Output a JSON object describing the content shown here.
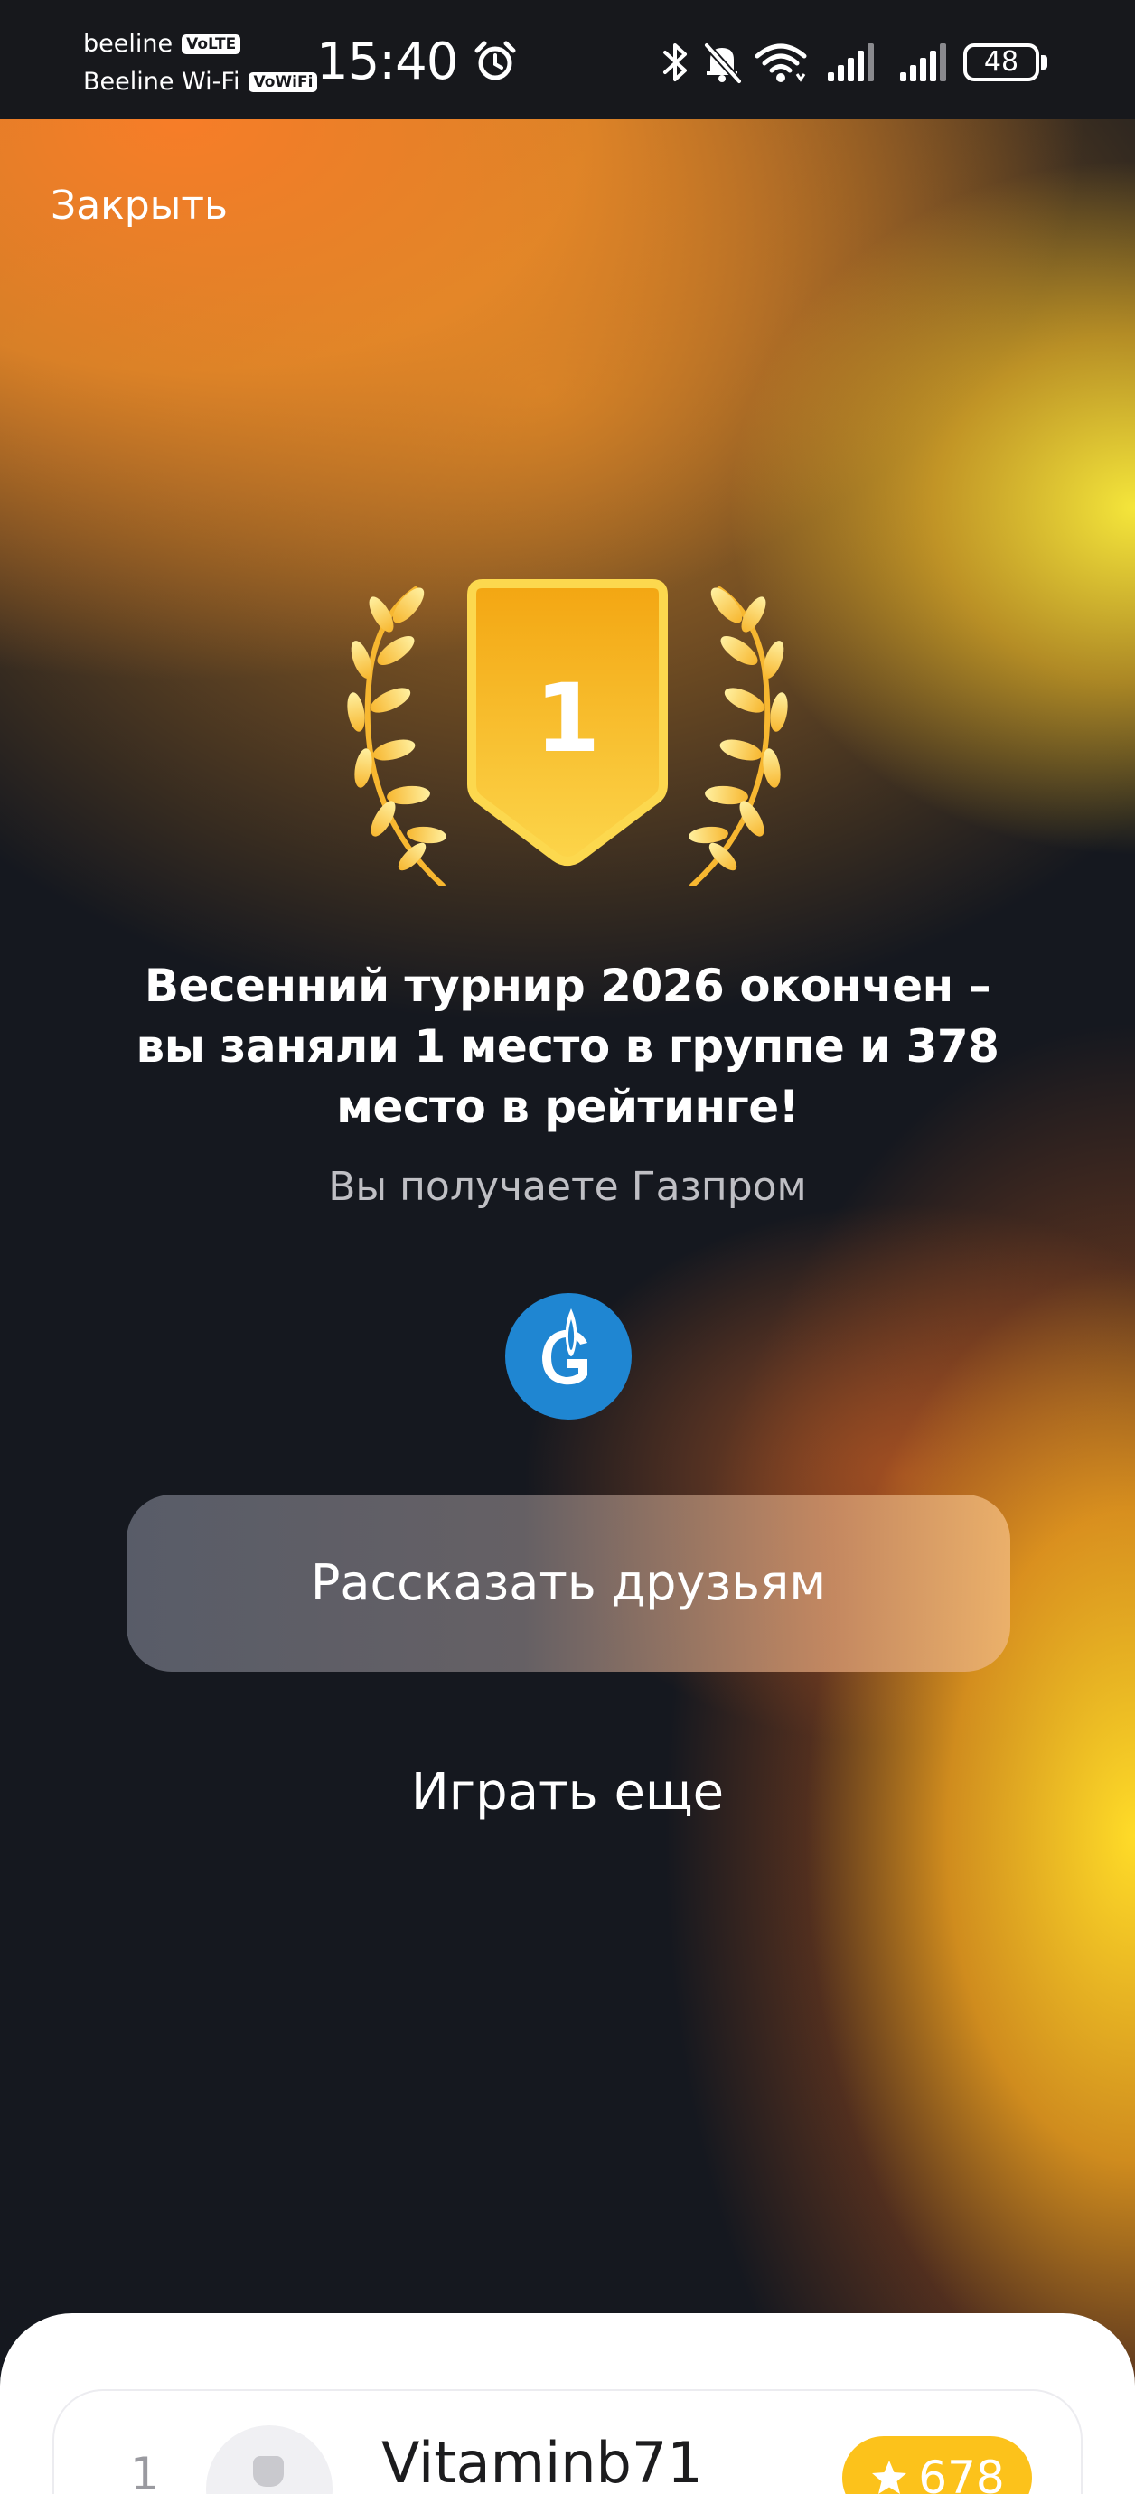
{
  "status_bar": {
    "carrier_1": "beeline",
    "carrier_1_tag": "VoLTE",
    "carrier_2": "Beeline Wi-Fi",
    "carrier_2_tag": "VoWiFi",
    "time": "15:40",
    "battery": "48",
    "icons": [
      "alarm-icon",
      "bluetooth-icon",
      "mute-icon",
      "wifi-icon",
      "signal-icon",
      "signal-icon"
    ]
  },
  "header": {
    "close_label": "Закрыть"
  },
  "result": {
    "place": "1",
    "headline": "Весенний турнир 2026 окончен – вы заняли 1 место в группе и 378 место в рейтинге!",
    "prize_text": "Вы получаете Газпром",
    "prize_icon": "gazprom-logo-icon"
  },
  "actions": {
    "share_label": "Рассказать друзьям",
    "play_again_label": "Играть еще"
  },
  "leaderboard": {
    "rows": [
      {
        "rank": "1",
        "name": "Vitaminb71",
        "score": "678"
      }
    ]
  },
  "colors": {
    "accent_gold": "#fcc21b",
    "prize_blue": "#1f86d2",
    "background_dark": "#15181f"
  }
}
